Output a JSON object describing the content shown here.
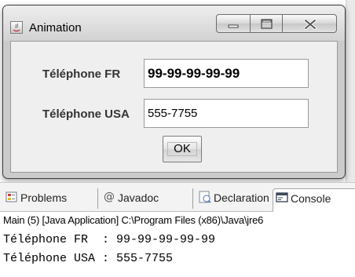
{
  "dialog": {
    "title": "Animation",
    "fields": [
      {
        "label": "Téléphone FR",
        "value": "99-99-99-99-99"
      },
      {
        "label": "Téléphone USA",
        "value": "555-7755"
      }
    ],
    "ok_label": "OK"
  },
  "panel": {
    "tabs": [
      {
        "label": "Problems",
        "icon": "problems-icon",
        "active": false
      },
      {
        "label": "Javadoc",
        "icon": "at-sign-icon",
        "active": false
      },
      {
        "label": "Declaration",
        "icon": "declaration-icon",
        "active": false
      },
      {
        "label": "Console",
        "icon": "console-icon",
        "active": true
      }
    ],
    "console": {
      "launch_line": "Main (5) [Java Application] C:\\Program Files (x86)\\Java\\jre6",
      "output": [
        "Téléphone FR  : 99-99-99-99-99",
        "Téléphone USA : 555-7755"
      ]
    }
  }
}
